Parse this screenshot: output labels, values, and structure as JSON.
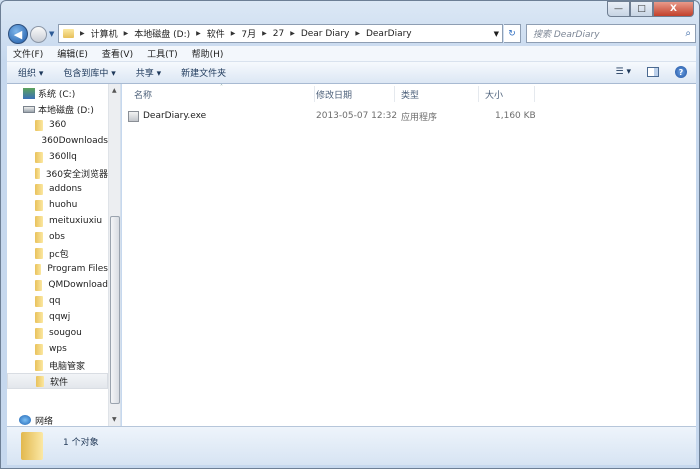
{
  "window": {
    "minimize": "—",
    "maximize": "□",
    "close": "X"
  },
  "nav": {
    "back": "◀",
    "history": "▼"
  },
  "address": {
    "crumbs": [
      "计算机",
      "本地磁盘 (D:)",
      "软件",
      "7月",
      "27",
      "Dear Diary",
      "DearDiary"
    ],
    "dropdown": "▼",
    "refresh": "↻"
  },
  "search": {
    "placeholder": "搜索 DearDiary",
    "icon": "⌕"
  },
  "menu": [
    "文件(F)",
    "编辑(E)",
    "查看(V)",
    "工具(T)",
    "帮助(H)"
  ],
  "toolbar": {
    "organize": "组织 ▾",
    "include_library": "包含到库中 ▾",
    "share": "共享 ▾",
    "new_folder": "新建文件夹",
    "views": "☰ ▾",
    "help": "?"
  },
  "tree": {
    "drives": [
      {
        "label": "系统 (C:)"
      },
      {
        "label": "本地磁盘 (D:)"
      }
    ],
    "folders": [
      "360",
      "360Downloads",
      "360llq",
      "360安全浏览器",
      "addons",
      "huohu",
      "meituxiuxiu",
      "obs",
      "pc包",
      "Program Files",
      "QMDownload",
      "qq",
      "qqwj",
      "sougou",
      "wps",
      "电脑管家",
      "软件"
    ],
    "selected": "软件",
    "network": "网络"
  },
  "columns": {
    "name": "名称",
    "modified": "修改日期",
    "type": "类型",
    "size": "大小"
  },
  "files": [
    {
      "name": "DearDiary.exe",
      "modified": "2013-05-07 12:32",
      "type": "应用程序",
      "size": "1,160 KB"
    }
  ],
  "status": {
    "count": "1 个对象"
  }
}
